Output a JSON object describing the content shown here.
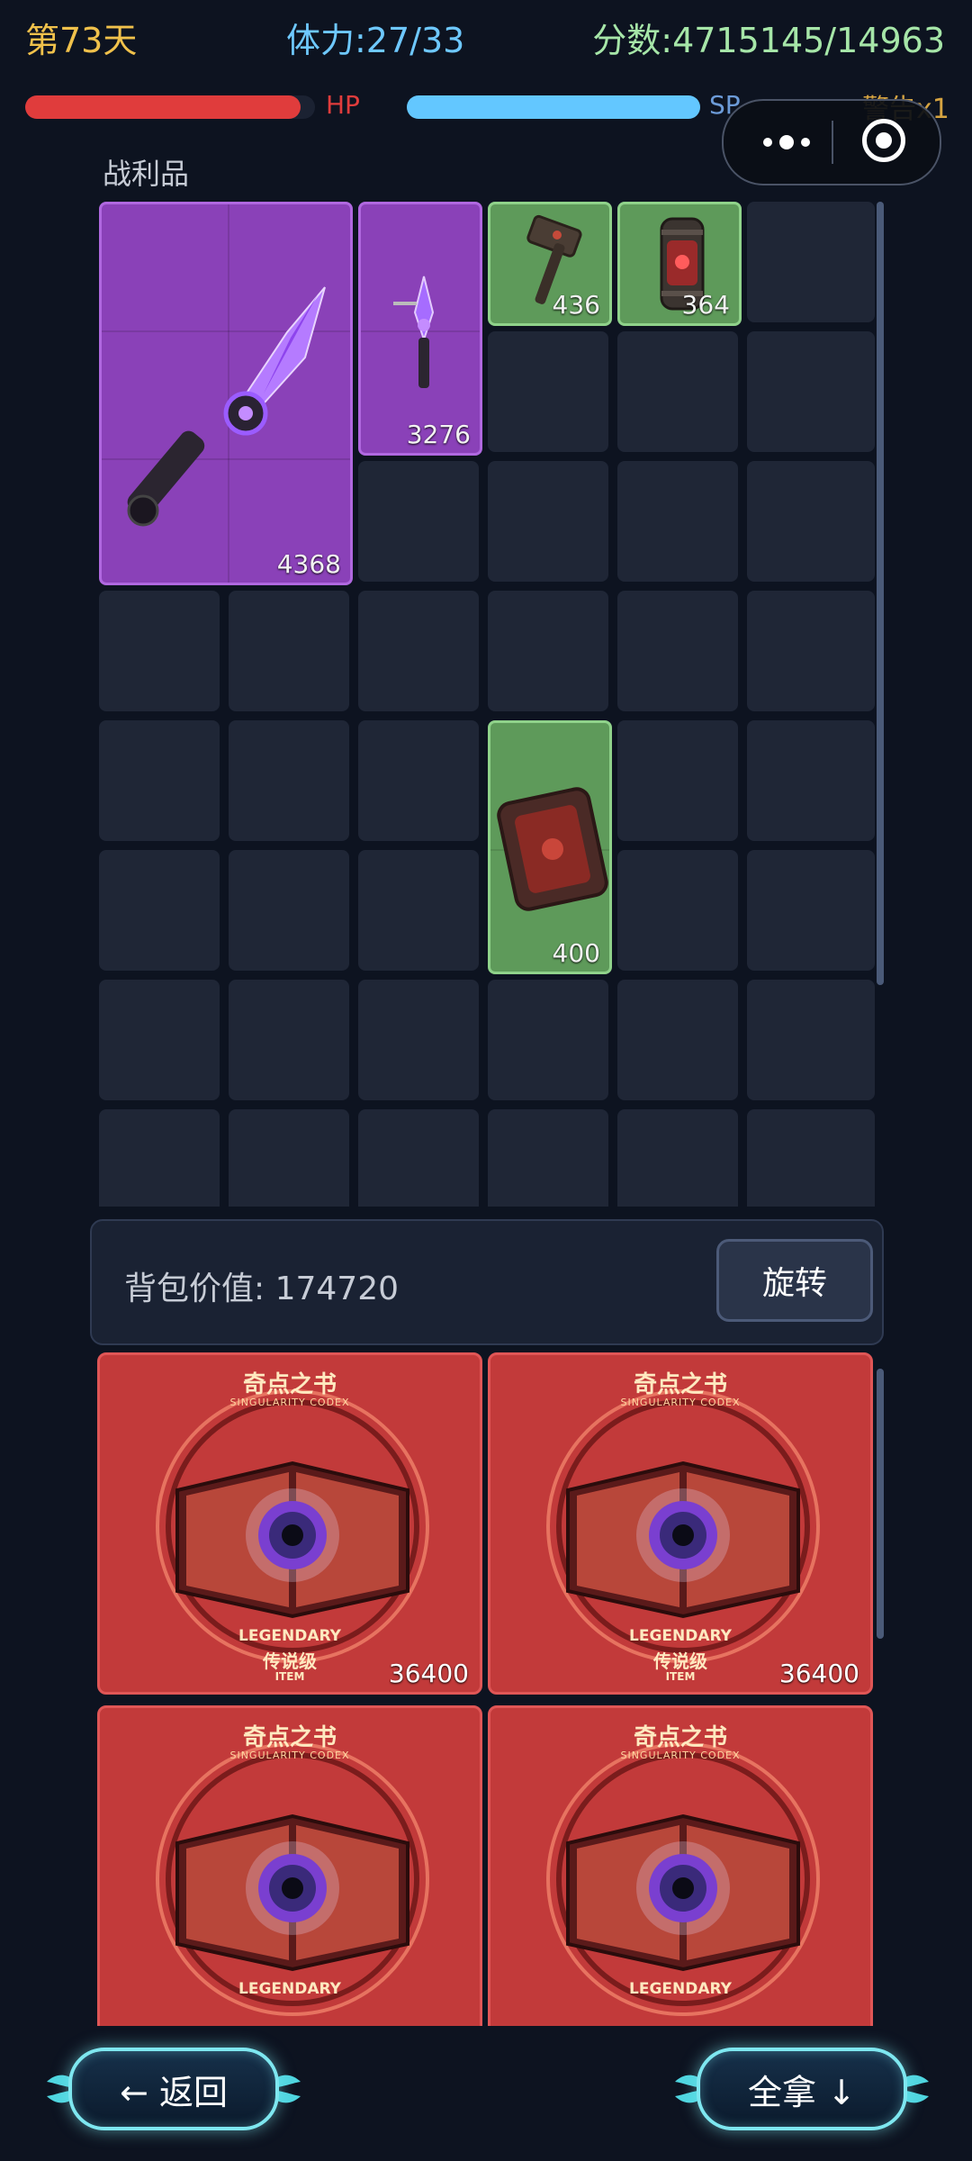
{
  "status": {
    "day": "第73天",
    "stamina": "体力:27/33",
    "score": "分数:4715145/14963",
    "hp_label": "HP",
    "sp_label": "SP",
    "warning": "警告x1",
    "hp_fraction": 0.95,
    "sp_fraction": 1.0
  },
  "capsule": {
    "more_icon": "more-dots-icon",
    "close_icon": "target-close-icon"
  },
  "loot": {
    "title": "战利品",
    "items": [
      {
        "name": "purple-dagger",
        "rarity": "purple",
        "value": "4368"
      },
      {
        "name": "purple-blade",
        "rarity": "purple",
        "value": "3276"
      },
      {
        "name": "green-hammer",
        "rarity": "green",
        "value": "436"
      },
      {
        "name": "green-canister",
        "rarity": "green",
        "value": "364"
      },
      {
        "name": "green-tome",
        "rarity": "green",
        "value": "400"
      }
    ]
  },
  "backpack": {
    "value_text": "背包价值: 174720",
    "rotate_label": "旋转"
  },
  "inventory": {
    "items": [
      {
        "title_cn": "奇点之书",
        "title_en": "SINGULARITY CODEX",
        "legendary": "LEGENDARY",
        "legendary_cn": "传说级",
        "tag": "ITEM",
        "value": "36400"
      },
      {
        "title_cn": "奇点之书",
        "title_en": "SINGULARITY CODEX",
        "legendary": "LEGENDARY",
        "legendary_cn": "传说级",
        "tag": "ITEM",
        "value": "36400"
      },
      {
        "title_cn": "奇点之书",
        "title_en": "SINGULARITY CODEX",
        "legendary": "LEGENDARY",
        "legendary_cn": "",
        "tag": "",
        "value": ""
      },
      {
        "title_cn": "奇点之书",
        "title_en": "SINGULARITY CODEX",
        "legendary": "LEGENDARY",
        "legendary_cn": "",
        "tag": "",
        "value": ""
      }
    ]
  },
  "buttons": {
    "back": "← 返回",
    "take_all": "全拿 ↓"
  },
  "colors": {
    "background": "#0d1320",
    "cell": "#1f2636",
    "purple": "#8a41b8",
    "green": "#5e9a5a",
    "legendary_red": "#c23a3a",
    "day": "#f0c14b",
    "stamina": "#6ec8ff",
    "score": "#a6e6a8"
  }
}
